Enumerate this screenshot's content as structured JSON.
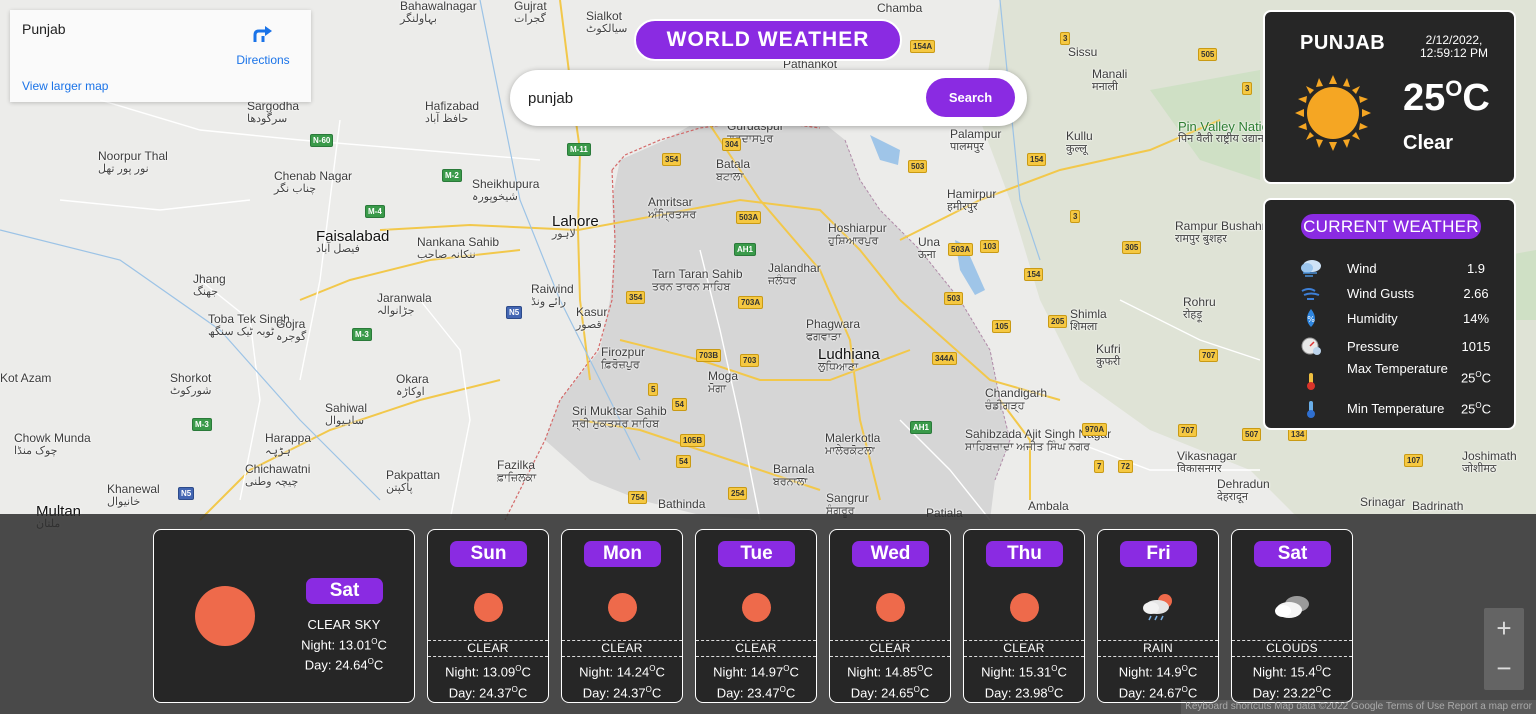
{
  "map": {
    "card": {
      "title": "Punjab",
      "directions_label": "Directions",
      "larger_map_label": "View larger map"
    },
    "places": [
      {
        "name": "Gujrat",
        "alt": "گجرات"
      },
      {
        "name": "Sialkot",
        "alt": "سیالکوٹ"
      },
      {
        "name": "Chamba",
        "alt": ""
      },
      {
        "name": "Bahawalnagar",
        "alt": "بہاولنگر"
      },
      {
        "name": "Pathankot",
        "alt": ""
      },
      {
        "name": "Sissu",
        "alt": ""
      },
      {
        "name": "Manali",
        "alt": "मनाली"
      },
      {
        "name": "Sargodha",
        "alt": "سرگودھا"
      },
      {
        "name": "Hafizabad",
        "alt": "حافظ آباد"
      },
      {
        "name": "Gurdaspur",
        "alt": "ਗੁਰਦਾਸਪੁਰ"
      },
      {
        "name": "Palampur",
        "alt": "पालमपुर"
      },
      {
        "name": "Kullu",
        "alt": "कुल्लू"
      },
      {
        "name": "Pin Valley National Park",
        "alt": "पिन वैली राष्ट्रीय उद्यान"
      },
      {
        "name": "Noorpur Thal",
        "alt": "نور پور تھل"
      },
      {
        "name": "Batala",
        "alt": "ਬਟਾਲਾ"
      },
      {
        "name": "Chenab Nagar",
        "alt": "چناب نگر"
      },
      {
        "name": "Sheikhupura",
        "alt": "شیخوپورہ"
      },
      {
        "name": "Amritsar",
        "alt": "ਅੰਮ੍ਰਿਤਸਰ"
      },
      {
        "name": "Hamirpur",
        "alt": "हमीरपुर"
      },
      {
        "name": "Lahore",
        "alt": "لاہور"
      },
      {
        "name": "Faisalabad",
        "alt": "فیصل آباد"
      },
      {
        "name": "Nankana Sahib",
        "alt": "ننکانہ صاحب"
      },
      {
        "name": "Hoshiarpur",
        "alt": "ਹੁਸ਼ਿਆਰਪੁਰ"
      },
      {
        "name": "Una",
        "alt": "ऊना"
      },
      {
        "name": "Rampur Bushahr",
        "alt": "रामपुर बुशहर"
      },
      {
        "name": "Jhang",
        "alt": "جھنگ"
      },
      {
        "name": "Tarn Taran Sahib",
        "alt": "ਤਰਨ ਤਾਰਨ ਸਾਹਿਬ"
      },
      {
        "name": "Jalandhar",
        "alt": "ਜਲੰਧਰ"
      },
      {
        "name": "Raiwind",
        "alt": "رائے ونڈ"
      },
      {
        "name": "Jaranwala",
        "alt": "جڑانوالہ"
      },
      {
        "name": "Kasur",
        "alt": "قصور"
      },
      {
        "name": "Rohru",
        "alt": "रोहड़ू"
      },
      {
        "name": "Toba Tek Singh",
        "alt": "ٹوبہ ٹیک سنگھ"
      },
      {
        "name": "Gojra",
        "alt": "گوجرہ"
      },
      {
        "name": "Shimla",
        "alt": "शिमला"
      },
      {
        "name": "Phagwara",
        "alt": "ਫਗਵਾੜਾ"
      },
      {
        "name": "Firozpur",
        "alt": "ਫ਼ਿਰੋਜ਼ਪੁਰ"
      },
      {
        "name": "Ludhiana",
        "alt": "ਲੁਧਿਆਣਾ"
      },
      {
        "name": "Kufri",
        "alt": "कुफरी"
      },
      {
        "name": "Moga",
        "alt": "ਮੋਗਾ"
      },
      {
        "name": "Shorkot",
        "alt": "شورکوٹ"
      },
      {
        "name": "Okara",
        "alt": "اوکاڑہ"
      },
      {
        "name": "Chandigarh",
        "alt": "ਚੰਡੀਗੜ੍ਹ"
      },
      {
        "name": "Sahiwal",
        "alt": "ساہیوال"
      },
      {
        "name": "Sri Muktsar Sahib",
        "alt": "ਸ੍ਰੀ ਮੁਕਤਸਰ ਸਾਹਿਬ"
      },
      {
        "name": "Malerkotla",
        "alt": "ਮਾਲੇਰਕੋਟਲਾ"
      },
      {
        "name": "Sahibzada Ajit Singh Nagar",
        "alt": "ਸਾਹਿਬਜ਼ਾਦਾ ਅਜੀਤ ਸਿੰਘ ਨਗਰ"
      },
      {
        "name": "Vikasnagar",
        "alt": "विकासनगर"
      },
      {
        "name": "Chowk Munda",
        "alt": "چوک منڈا"
      },
      {
        "name": "Harappa",
        "alt": "ہڑپہ"
      },
      {
        "name": "Chichawatni",
        "alt": "چیچہ وطنی"
      },
      {
        "name": "Fazilka",
        "alt": "ਫ਼ਾਜ਼ਿਲਕਾ"
      },
      {
        "name": "Barnala",
        "alt": "ਬਰਨਾਲਾ"
      },
      {
        "name": "Pakpattan",
        "alt": "پاکپتن"
      },
      {
        "name": "Khanewal",
        "alt": "خانیوال"
      },
      {
        "name": "Dehradun",
        "alt": "देहरादून"
      },
      {
        "name": "Bathinda",
        "alt": ""
      },
      {
        "name": "Sangrur",
        "alt": "ਸੰਗਰੂਰ"
      },
      {
        "name": "Patiala",
        "alt": ""
      },
      {
        "name": "Ambala",
        "alt": ""
      },
      {
        "name": "Multan",
        "alt": "ملتان"
      },
      {
        "name": "Srinagar",
        "alt": ""
      },
      {
        "name": "Badrinath",
        "alt": ""
      },
      {
        "name": "Kot Azam",
        "alt": ""
      },
      {
        "name": "Joshimath",
        "alt": "जोशीमठ"
      }
    ],
    "shields": [
      "N-60",
      "M-11",
      "M-2",
      "M-4",
      "M-3",
      "N5",
      "M-3",
      "N5",
      "354",
      "304",
      "154A",
      "3",
      "505",
      "503",
      "154",
      "3",
      "305",
      "503A",
      "103",
      "154",
      "503",
      "105",
      "205",
      "707",
      "344A",
      "703B",
      "703",
      "703A",
      "503A",
      "AH1",
      "354",
      "5",
      "54",
      "105B",
      "54",
      "754",
      "254",
      "AH1",
      "970A",
      "707",
      "507",
      "134",
      "107",
      "7",
      "72",
      "3"
    ],
    "zoom_in": "+",
    "zoom_out": "−",
    "attribution": "Keyboard shortcuts   Map data ©2022 Google   Terms of Use   Report a map error"
  },
  "header": {
    "brand": "WORLD WEATHER"
  },
  "search": {
    "value": "punjab",
    "placeholder": "",
    "button_label": "Search"
  },
  "current": {
    "city": "PUNJAB",
    "date": "2/12/2022,",
    "time": "12:59:12 PM",
    "temp": "25",
    "unit": "C",
    "deg": "O",
    "condition": "Clear",
    "icon": "sun-icon"
  },
  "details": {
    "title": "CURRENT WEATHER",
    "rows": [
      {
        "label": "Wind",
        "value": "1.9",
        "icon": "wind-cloud-icon"
      },
      {
        "label": "Wind Gusts",
        "value": "2.66",
        "icon": "gust-icon"
      },
      {
        "label": "Humidity",
        "value": "14%",
        "icon": "humidity-icon"
      },
      {
        "label": "Pressure",
        "value": "1015",
        "icon": "pressure-icon"
      },
      {
        "label": "Max Temperature",
        "value": "25",
        "unit": "C",
        "icon": "thermometer-hot-icon"
      },
      {
        "label": "Min Temperature",
        "value": "25",
        "unit": "C",
        "icon": "thermometer-cold-icon"
      }
    ]
  },
  "forecast": {
    "today": {
      "day": "Sat",
      "condition": "CLEAR SKY",
      "night_label": "Night:",
      "night": "13.01",
      "day_label": "Day:",
      "day_temp": "24.64",
      "unit": "C"
    },
    "days": [
      {
        "day": "Sun",
        "condition": "CLEAR",
        "night": "13.09",
        "day_temp": "24.37",
        "icon": "sun-ball-icon"
      },
      {
        "day": "Mon",
        "condition": "CLEAR",
        "night": "14.24",
        "day_temp": "24.37",
        "icon": "sun-ball-icon"
      },
      {
        "day": "Tue",
        "condition": "CLEAR",
        "night": "14.97",
        "day_temp": "23.47",
        "icon": "sun-ball-icon"
      },
      {
        "day": "Wed",
        "condition": "CLEAR",
        "night": "14.85",
        "day_temp": "24.65",
        "icon": "sun-ball-icon"
      },
      {
        "day": "Thu",
        "condition": "CLEAR",
        "night": "15.31",
        "day_temp": "23.98",
        "icon": "sun-ball-icon"
      },
      {
        "day": "Fri",
        "condition": "RAIN",
        "night": "14.9",
        "day_temp": "24.67",
        "icon": "rain-cloud-icon"
      },
      {
        "day": "Sat",
        "condition": "CLOUDS",
        "night": "15.4",
        "day_temp": "23.22",
        "icon": "clouds-icon"
      }
    ],
    "night_label": "Night:",
    "day_label": "Day:",
    "unit": "C",
    "deg": "O"
  },
  "colors": {
    "accent": "#8a2be2",
    "panel": "#262626",
    "sun": "#f5a623",
    "ball": "#ee6a4b"
  }
}
